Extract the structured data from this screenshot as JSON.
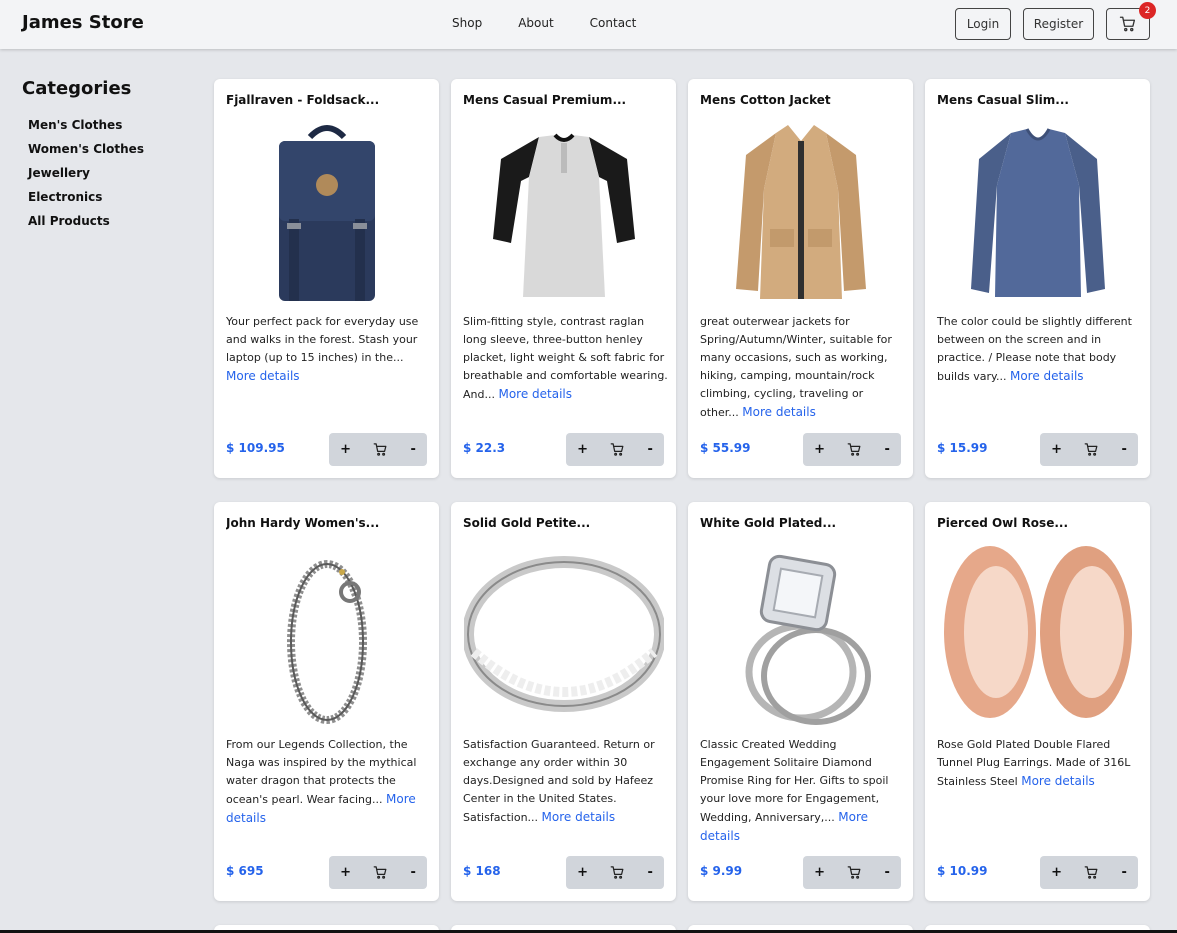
{
  "header": {
    "brand": "James Store",
    "nav": [
      "Shop",
      "About",
      "Contact"
    ],
    "login": "Login",
    "register": "Register",
    "cart_count": "2"
  },
  "sidebar": {
    "title": "Categories",
    "items": [
      "Men's Clothes",
      "Women's Clothes",
      "Jewellery",
      "Electronics",
      "All Products"
    ]
  },
  "more_label": "More details",
  "qty_labels": {
    "plus": "+",
    "minus": "-"
  },
  "products": [
    {
      "title": "Fjallraven - Foldsack...",
      "desc": "Your perfect pack for everyday use and walks in the forest. Stash your laptop (up to 15 inches) in the...",
      "price": "$ 109.95",
      "image": "backpack"
    },
    {
      "title": "Mens Casual Premium...",
      "desc": "Slim-fitting style, contrast raglan long sleeve, three-button henley placket, light weight & soft fabric for breathable and comfortable wearing. And...",
      "price": "$ 22.3",
      "image": "raglan-tshirt"
    },
    {
      "title": "Mens Cotton Jacket",
      "desc": "great outerwear jackets for Spring/Autumn/Winter, suitable for many occasions, such as working, hiking, camping, mountain/rock climbing, cycling, traveling or other...",
      "price": "$ 55.99",
      "image": "jacket"
    },
    {
      "title": "Mens Casual Slim...",
      "desc": "The color could be slightly different between on the screen and in practice. / Please note that body builds vary...",
      "price": "$ 15.99",
      "image": "longsleeve-shirt"
    },
    {
      "title": "John Hardy Women's...",
      "desc": "From our Legends Collection, the Naga was inspired by the mythical water dragon that protects the ocean's pearl. Wear facing...",
      "price": "$ 695",
      "image": "dragon-bracelet"
    },
    {
      "title": "Solid Gold Petite...",
      "desc": "Satisfaction Guaranteed. Return or exchange any order within 30 days.Designed and sold by Hafeez Center in the United States. Satisfaction...",
      "price": "$ 168",
      "image": "silver-ring"
    },
    {
      "title": "White Gold Plated...",
      "desc": "Classic Created Wedding Engagement Solitaire Diamond Promise Ring for Her. Gifts to spoil your love more for Engagement, Wedding, Anniversary,...",
      "price": "$ 9.99",
      "image": "diamond-ring"
    },
    {
      "title": "Pierced Owl Rose...",
      "desc": "Rose Gold Plated Double Flared Tunnel Plug Earrings. Made of 316L Stainless Steel",
      "price": "$ 10.99",
      "image": "tunnel-plugs"
    }
  ]
}
